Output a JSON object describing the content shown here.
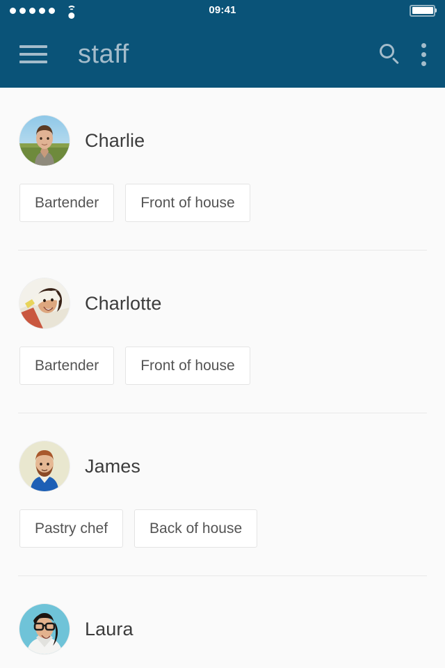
{
  "status_bar": {
    "signal_dots": 5,
    "wifi_icon": "wifi-icon",
    "time": "09:41",
    "battery_icon": "battery-full-icon"
  },
  "app_bar": {
    "menu_icon": "hamburger-menu-icon",
    "title": "staff",
    "search_icon": "search-icon",
    "overflow_icon": "overflow-menu-icon",
    "background_color": "#0a5378",
    "foreground_color": "#a4bccb"
  },
  "theme": {
    "page_background": "#fafafa",
    "chip_border": "#e4e4e4",
    "chip_text": "#545454",
    "name_text": "#3c3c3c",
    "divider": "#e8e8e8"
  },
  "staff": [
    {
      "name": "Charlie",
      "avatar": "avatar-charlie",
      "tags": [
        "Bartender",
        "Front of house"
      ]
    },
    {
      "name": "Charlotte",
      "avatar": "avatar-charlotte",
      "tags": [
        "Bartender",
        "Front of house"
      ]
    },
    {
      "name": "James",
      "avatar": "avatar-james",
      "tags": [
        "Pastry chef",
        "Back of house"
      ]
    },
    {
      "name": "Laura",
      "avatar": "avatar-laura",
      "tags": []
    }
  ]
}
